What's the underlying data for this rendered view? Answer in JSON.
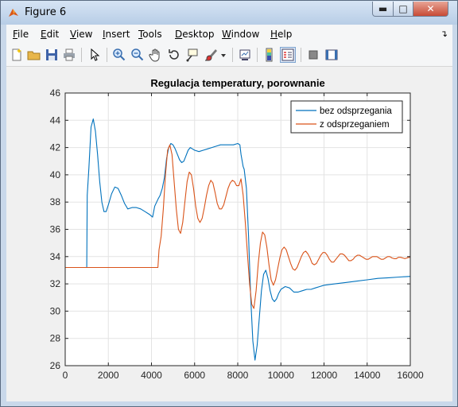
{
  "window": {
    "title": "Figure 6"
  },
  "menu": {
    "items": [
      {
        "id": "file",
        "label": "File",
        "mnemonic_index": 0
      },
      {
        "id": "edit",
        "label": "Edit",
        "mnemonic_index": 0
      },
      {
        "id": "view",
        "label": "View",
        "mnemonic_index": 0
      },
      {
        "id": "insert",
        "label": "Insert",
        "mnemonic_index": 0
      },
      {
        "id": "tools",
        "label": "Tools",
        "mnemonic_index": 0
      },
      {
        "id": "desktop",
        "label": "Desktop",
        "mnemonic_index": 0
      },
      {
        "id": "window",
        "label": "Window",
        "mnemonic_index": 0
      },
      {
        "id": "help",
        "label": "Help",
        "mnemonic_index": 0
      }
    ]
  },
  "toolbar": {
    "buttons": [
      "new-figure",
      "open-file",
      "save",
      "print",
      "pointer",
      "zoom-in",
      "zoom-out",
      "pan",
      "rotate-3d",
      "data-cursor",
      "brush",
      "brush-dropdown",
      "link-plot",
      "insert-colorbar",
      "insert-legend",
      "hide-plot-tools",
      "show-plot-tools"
    ]
  },
  "chart_data": {
    "type": "line",
    "title": "Regulacja temperatury, porownanie",
    "xlabel": "",
    "ylabel": "",
    "xlim": [
      0,
      16000
    ],
    "ylim": [
      26,
      46
    ],
    "xticks": [
      0,
      2000,
      4000,
      6000,
      8000,
      10000,
      12000,
      14000,
      16000
    ],
    "yticks": [
      26,
      28,
      30,
      32,
      34,
      36,
      38,
      40,
      42,
      44,
      46
    ],
    "grid": true,
    "legend_position": "top-right",
    "series": [
      {
        "name": "bez odsprzegania",
        "color": "#0072bd",
        "points": [
          [
            0,
            33.2
          ],
          [
            1000,
            33.2
          ],
          [
            1020,
            38.5
          ],
          [
            1100,
            40.5
          ],
          [
            1200,
            43.5
          ],
          [
            1300,
            44.1
          ],
          [
            1400,
            43.2
          ],
          [
            1500,
            41.5
          ],
          [
            1600,
            39.5
          ],
          [
            1700,
            38.0
          ],
          [
            1800,
            37.3
          ],
          [
            1900,
            37.3
          ],
          [
            2000,
            37.8
          ],
          [
            2150,
            38.6
          ],
          [
            2300,
            39.1
          ],
          [
            2450,
            39.0
          ],
          [
            2600,
            38.5
          ],
          [
            2750,
            37.9
          ],
          [
            2900,
            37.5
          ],
          [
            3100,
            37.6
          ],
          [
            3300,
            37.6
          ],
          [
            3500,
            37.5
          ],
          [
            3700,
            37.3
          ],
          [
            3900,
            37.1
          ],
          [
            4050,
            36.9
          ],
          [
            4150,
            37.7
          ],
          [
            4300,
            38.2
          ],
          [
            4400,
            38.5
          ],
          [
            4500,
            39.0
          ],
          [
            4600,
            39.8
          ],
          [
            4700,
            41.2
          ],
          [
            4800,
            42.0
          ],
          [
            4900,
            42.3
          ],
          [
            5000,
            42.2
          ],
          [
            5100,
            41.9
          ],
          [
            5200,
            41.5
          ],
          [
            5300,
            41.1
          ],
          [
            5400,
            40.9
          ],
          [
            5500,
            41.0
          ],
          [
            5600,
            41.4
          ],
          [
            5700,
            41.8
          ],
          [
            5800,
            42.0
          ],
          [
            5900,
            41.9
          ],
          [
            6000,
            41.8
          ],
          [
            6200,
            41.7
          ],
          [
            6400,
            41.8
          ],
          [
            6600,
            41.9
          ],
          [
            6800,
            42.0
          ],
          [
            7000,
            42.1
          ],
          [
            7200,
            42.2
          ],
          [
            7400,
            42.2
          ],
          [
            7600,
            42.2
          ],
          [
            7800,
            42.2
          ],
          [
            8000,
            42.3
          ],
          [
            8100,
            42.2
          ],
          [
            8150,
            41.5
          ],
          [
            8250,
            40.6
          ],
          [
            8300,
            40.4
          ],
          [
            8400,
            39.0
          ],
          [
            8500,
            35.5
          ],
          [
            8600,
            31.0
          ],
          [
            8700,
            27.8
          ],
          [
            8800,
            26.4
          ],
          [
            8900,
            27.5
          ],
          [
            9000,
            29.5
          ],
          [
            9100,
            31.5
          ],
          [
            9200,
            32.7
          ],
          [
            9300,
            33.0
          ],
          [
            9400,
            32.4
          ],
          [
            9500,
            31.5
          ],
          [
            9600,
            30.9
          ],
          [
            9700,
            30.7
          ],
          [
            9800,
            30.9
          ],
          [
            9900,
            31.3
          ],
          [
            10000,
            31.6
          ],
          [
            10200,
            31.8
          ],
          [
            10400,
            31.7
          ],
          [
            10600,
            31.4
          ],
          [
            10800,
            31.4
          ],
          [
            11000,
            31.5
          ],
          [
            11200,
            31.6
          ],
          [
            11400,
            31.6
          ],
          [
            11600,
            31.7
          ],
          [
            11800,
            31.8
          ],
          [
            12000,
            31.9
          ],
          [
            12500,
            32.0
          ],
          [
            13000,
            32.1
          ],
          [
            13500,
            32.2
          ],
          [
            14000,
            32.3
          ],
          [
            14500,
            32.4
          ],
          [
            15000,
            32.45
          ],
          [
            15500,
            32.5
          ],
          [
            16000,
            32.55
          ]
        ]
      },
      {
        "name": "z odsprzeganiem",
        "color": "#d95319",
        "points": [
          [
            0,
            33.2
          ],
          [
            4300,
            33.2
          ],
          [
            4350,
            34.5
          ],
          [
            4450,
            35.5
          ],
          [
            4550,
            37.5
          ],
          [
            4650,
            40.0
          ],
          [
            4750,
            41.8
          ],
          [
            4850,
            42.2
          ],
          [
            4950,
            41.5
          ],
          [
            5050,
            39.5
          ],
          [
            5150,
            37.5
          ],
          [
            5250,
            36.0
          ],
          [
            5350,
            35.7
          ],
          [
            5450,
            36.5
          ],
          [
            5550,
            38.0
          ],
          [
            5650,
            39.5
          ],
          [
            5750,
            40.2
          ],
          [
            5850,
            40.0
          ],
          [
            5950,
            39.0
          ],
          [
            6050,
            37.7
          ],
          [
            6150,
            36.8
          ],
          [
            6250,
            36.5
          ],
          [
            6350,
            36.8
          ],
          [
            6450,
            37.6
          ],
          [
            6550,
            38.5
          ],
          [
            6650,
            39.2
          ],
          [
            6750,
            39.6
          ],
          [
            6850,
            39.4
          ],
          [
            6950,
            38.7
          ],
          [
            7050,
            37.9
          ],
          [
            7150,
            37.5
          ],
          [
            7250,
            37.5
          ],
          [
            7350,
            37.8
          ],
          [
            7450,
            38.4
          ],
          [
            7550,
            39.0
          ],
          [
            7650,
            39.4
          ],
          [
            7750,
            39.6
          ],
          [
            7850,
            39.5
          ],
          [
            7950,
            39.2
          ],
          [
            8050,
            39.2
          ],
          [
            8150,
            39.7
          ],
          [
            8250,
            38.5
          ],
          [
            8350,
            36.5
          ],
          [
            8450,
            34.2
          ],
          [
            8550,
            32.0
          ],
          [
            8650,
            30.5
          ],
          [
            8750,
            30.2
          ],
          [
            8850,
            31.5
          ],
          [
            8950,
            33.5
          ],
          [
            9050,
            35.0
          ],
          [
            9150,
            35.8
          ],
          [
            9250,
            35.6
          ],
          [
            9350,
            34.7
          ],
          [
            9450,
            33.4
          ],
          [
            9550,
            32.3
          ],
          [
            9650,
            31.9
          ],
          [
            9750,
            32.3
          ],
          [
            9850,
            33.1
          ],
          [
            9950,
            33.9
          ],
          [
            10050,
            34.5
          ],
          [
            10150,
            34.7
          ],
          [
            10250,
            34.5
          ],
          [
            10350,
            34.0
          ],
          [
            10450,
            33.5
          ],
          [
            10550,
            33.1
          ],
          [
            10650,
            33.0
          ],
          [
            10750,
            33.2
          ],
          [
            10850,
            33.6
          ],
          [
            10950,
            34.0
          ],
          [
            11050,
            34.3
          ],
          [
            11150,
            34.4
          ],
          [
            11250,
            34.2
          ],
          [
            11350,
            33.9
          ],
          [
            11450,
            33.5
          ],
          [
            11550,
            33.4
          ],
          [
            11650,
            33.5
          ],
          [
            11750,
            33.8
          ],
          [
            11850,
            34.1
          ],
          [
            11950,
            34.3
          ],
          [
            12050,
            34.3
          ],
          [
            12150,
            34.1
          ],
          [
            12250,
            33.8
          ],
          [
            12350,
            33.6
          ],
          [
            12450,
            33.6
          ],
          [
            12550,
            33.8
          ],
          [
            12650,
            34.0
          ],
          [
            12750,
            34.2
          ],
          [
            12850,
            34.2
          ],
          [
            12950,
            34.1
          ],
          [
            13050,
            33.9
          ],
          [
            13150,
            33.7
          ],
          [
            13250,
            33.7
          ],
          [
            13350,
            33.8
          ],
          [
            13450,
            34.0
          ],
          [
            13550,
            34.1
          ],
          [
            13650,
            34.1
          ],
          [
            13750,
            34.0
          ],
          [
            13850,
            33.9
          ],
          [
            13950,
            33.8
          ],
          [
            14050,
            33.8
          ],
          [
            14150,
            33.9
          ],
          [
            14250,
            34.0
          ],
          [
            14350,
            34.0
          ],
          [
            14450,
            34.0
          ],
          [
            14550,
            33.9
          ],
          [
            14650,
            33.8
          ],
          [
            14750,
            33.8
          ],
          [
            14850,
            33.9
          ],
          [
            14950,
            34.0
          ],
          [
            15050,
            34.0
          ],
          [
            15150,
            33.9
          ],
          [
            15250,
            33.85
          ],
          [
            15350,
            33.85
          ],
          [
            15450,
            33.95
          ],
          [
            15550,
            33.95
          ],
          [
            15650,
            33.9
          ],
          [
            15750,
            33.85
          ],
          [
            15850,
            33.9
          ],
          [
            15950,
            33.95
          ],
          [
            16000,
            33.95
          ]
        ]
      }
    ]
  }
}
